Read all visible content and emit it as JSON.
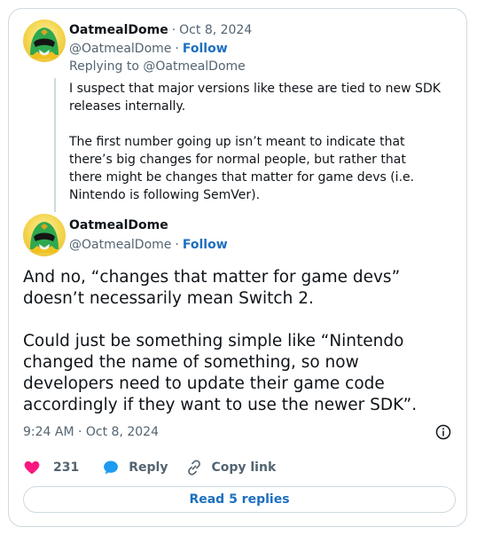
{
  "parent_post": {
    "display_name": "OatmealDome",
    "date": "Oct 8, 2024",
    "handle": "@OatmealDome",
    "follow_label": "Follow",
    "replying_to": "Replying to @OatmealDome",
    "paragraphs": [
      "I suspect that major versions like these are tied to new SDK releases internally.",
      "The first number going up isn’t meant to indicate that there’s big changes for normal people, but rather that there might be changes that matter for game devs (i.e. Nintendo is following SemVer)."
    ]
  },
  "main_post": {
    "display_name": "OatmealDome",
    "handle": "@OatmealDome",
    "follow_label": "Follow",
    "paragraphs": [
      "And no, “changes that matter for game devs” doesn’t necessarily mean Switch 2.",
      "Could just be something simple like “Nintendo changed the name of something, so now developers need to update their game code accordingly if they want to use the newer SDK”."
    ],
    "timestamp": "9:24 AM · Oct 8, 2024"
  },
  "actions": {
    "like_count": "231",
    "reply_label": "Reply",
    "copy_label": "Copy link"
  },
  "read_replies_label": "Read 5 replies",
  "icons": {
    "heart": "heart-icon",
    "reply": "reply-bubble-icon",
    "copy": "link-icon",
    "info": "info-icon",
    "avatar": "green-ranger-avatar"
  },
  "colors": {
    "like": "#f91880",
    "reply": "#1d9bf0",
    "link": "#1d6fc0",
    "muted": "#536471",
    "border": "#cfd9de"
  }
}
